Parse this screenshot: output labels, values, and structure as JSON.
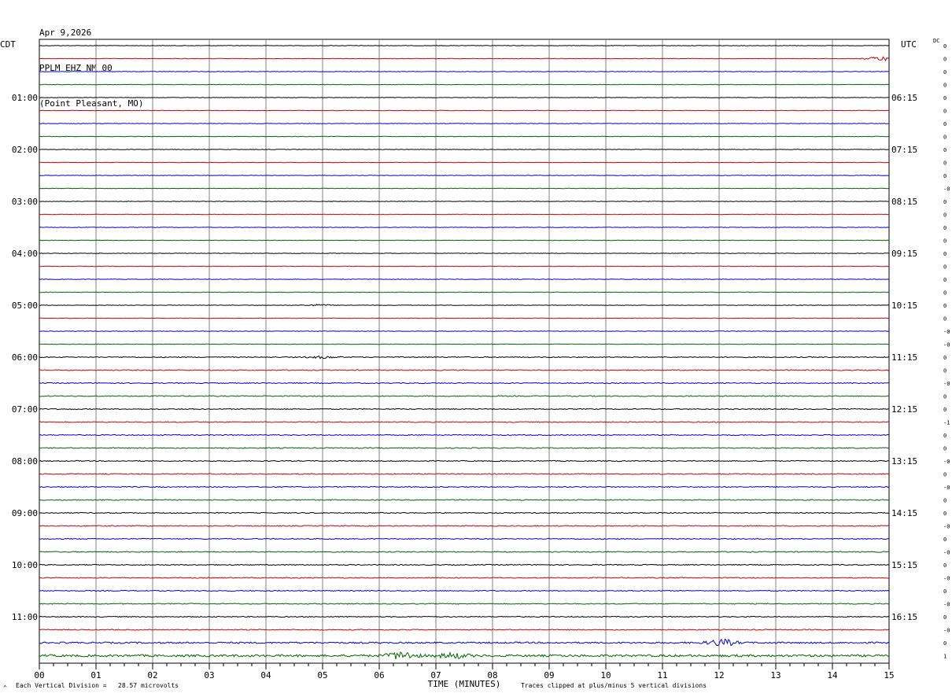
{
  "header": {
    "date": "Apr 9,2026",
    "station": "PPLM EHZ NM 00",
    "location": "(Point Pleasant, MO)"
  },
  "left_timezone": "CDT",
  "right_timezone": "UTC",
  "dc_label": "DC",
  "footer": {
    "scale_text": "Each Vertical Division =   28.57 microvolts",
    "clip_text": "Traces clipped at plus/minus 5 vertical divisions",
    "corner_mark": "^"
  },
  "colors": {
    "trace_cycle": [
      "#000000",
      "#cc0000",
      "#0000cc",
      "#006600"
    ],
    "grid": "#808080"
  },
  "chart_data": {
    "type": "line",
    "title": "PPLM EHZ NM 00",
    "xlabel": "TIME (MINUTES)",
    "xlim": [
      0,
      15
    ],
    "x_ticks": [
      "00",
      "01",
      "02",
      "03",
      "04",
      "05",
      "06",
      "07",
      "08",
      "09",
      "10",
      "11",
      "12",
      "13",
      "14",
      "15"
    ],
    "left_hour_labels": [
      "01:00",
      "02:00",
      "03:00",
      "04:00",
      "05:00",
      "06:00",
      "07:00",
      "08:00",
      "09:00",
      "10:00",
      "11:00"
    ],
    "right_hour_labels": [
      "06:15",
      "07:15",
      "08:15",
      "09:15",
      "10:15",
      "11:15",
      "12:15",
      "13:15",
      "14:15",
      "15:15",
      "16:15"
    ],
    "trace_count": 48,
    "dc_offsets": [
      "0",
      "0",
      "0",
      "0",
      "0",
      "0",
      "0",
      "0",
      "0",
      "0",
      "0",
      "-0",
      "0",
      "0",
      "0",
      "0",
      "0",
      "0",
      "0",
      "0",
      "0",
      "0",
      "-0",
      "-0",
      "0",
      "0",
      "-0",
      "0",
      "0",
      "-1",
      "0",
      "0",
      "-0",
      "0",
      "-0",
      "0",
      "0",
      "-0",
      "0",
      "-0",
      "0",
      "-0",
      "0",
      "-0",
      "0",
      "-0",
      "0",
      "1"
    ],
    "trace_amplitudes": [
      0.3,
      0.3,
      0.3,
      0.3,
      0.3,
      0.3,
      0.3,
      0.3,
      0.3,
      0.3,
      0.3,
      0.3,
      0.3,
      0.3,
      0.3,
      0.3,
      0.3,
      0.3,
      0.3,
      0.3,
      0.3,
      0.3,
      0.3,
      0.3,
      0.6,
      0.6,
      0.6,
      0.6,
      0.6,
      0.6,
      0.6,
      0.6,
      0.6,
      0.6,
      0.6,
      0.6,
      0.6,
      0.6,
      0.6,
      0.6,
      0.6,
      0.6,
      0.6,
      0.6,
      0.6,
      0.6,
      1.0,
      1.4
    ],
    "events": [
      {
        "trace": 1,
        "minute": 14.85,
        "amplitude": 2.5
      },
      {
        "trace": 20,
        "minute": 4.9,
        "amplitude": 1.0
      },
      {
        "trace": 24,
        "minute": 5.0,
        "amplitude": 1.2
      },
      {
        "trace": 46,
        "minute": 12.05,
        "amplitude": 4.0
      },
      {
        "trace": 47,
        "minute": 6.4,
        "amplitude": 4.5
      },
      {
        "trace": 47,
        "minute": 7.3,
        "amplitude": 3.0
      }
    ]
  }
}
